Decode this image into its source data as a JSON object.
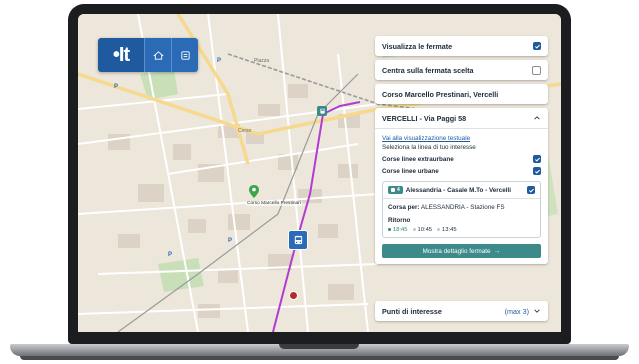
{
  "app": {
    "logo_text": "•It",
    "home_icon": "home-icon",
    "list_icon": "list-icon"
  },
  "map": {
    "labels": {
      "marker_label": "Corso Marcello Prestinari",
      "street_lane": "Via Crosa"
    },
    "route_color": "#b23bd0",
    "bus_stop_color": "#2b6bb6"
  },
  "panel": {
    "show_stops_label": "Visualizza le fermate",
    "show_stops_checked": true,
    "center_stop_label": "Centra sulla fermata scelta",
    "center_stop_checked": false,
    "selected_street": "Corso Marcello Prestinari, Vercelli",
    "stop_title": "VERCELLI - Via Paggi 58",
    "text_view_link": "Vai alla visualizzazione testuale",
    "select_line_hint": "Seleziona la linea di tuo interesse",
    "extra_urban_label": "Corse linee extraurbane",
    "urban_label": "Corse linee urbane",
    "line": {
      "badge": "4",
      "name": "Alessandria - Casale M.To - Vercelli",
      "direction_label": "Corsa per:",
      "direction": "ALESSANDRIA - Stazione FS",
      "return_label": "Ritorno",
      "times": [
        "18:45",
        "10:45",
        "13:45"
      ]
    },
    "details_button": "Mostra dettaglio fermate",
    "details_arrow": "→"
  },
  "poi": {
    "label": "Punti di interesse",
    "max": "(max 3)"
  }
}
